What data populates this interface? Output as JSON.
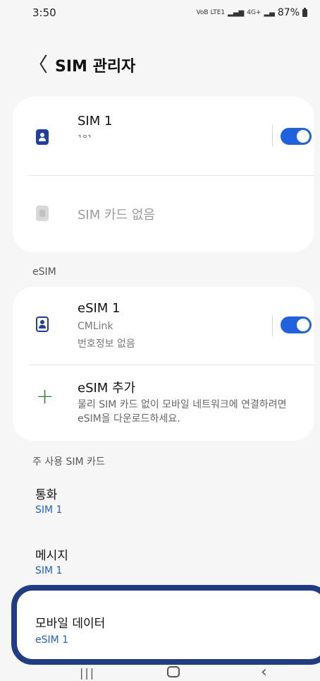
{
  "status": {
    "time": "3:50",
    "network_label": "VoB LTE1",
    "signal_label": "4G+",
    "battery": "87%"
  },
  "header": {
    "back_icon": "back-chevron-icon",
    "title": "SIM 관리자"
  },
  "sim_section": {
    "sim1": {
      "name": "SIM 1",
      "number_partial": "181",
      "enabled": true
    },
    "sim2": {
      "status": "SIM 카드 없음"
    }
  },
  "esim_section": {
    "label": "eSIM",
    "esim1": {
      "name": "eSIM 1",
      "carrier": "CMLink",
      "number": "번호정보 없음",
      "enabled": true
    },
    "add": {
      "title": "eSIM 추가",
      "description": "물리 SIM 카드 없이 모바일 네트워크에 연결하려면 eSIM을 다운로드하세요."
    }
  },
  "preferred_section": {
    "label": "주 사용 SIM 카드",
    "calls": {
      "title": "통화",
      "value": "SIM 1"
    },
    "messages": {
      "title": "메시지",
      "value": "SIM 1"
    },
    "mobile_data": {
      "title": "모바일 데이터",
      "value": "eSIM 1"
    }
  },
  "colors": {
    "accent": "#1f62e0",
    "highlight_border": "#203c85",
    "value_blue": "#1f5fd6"
  }
}
